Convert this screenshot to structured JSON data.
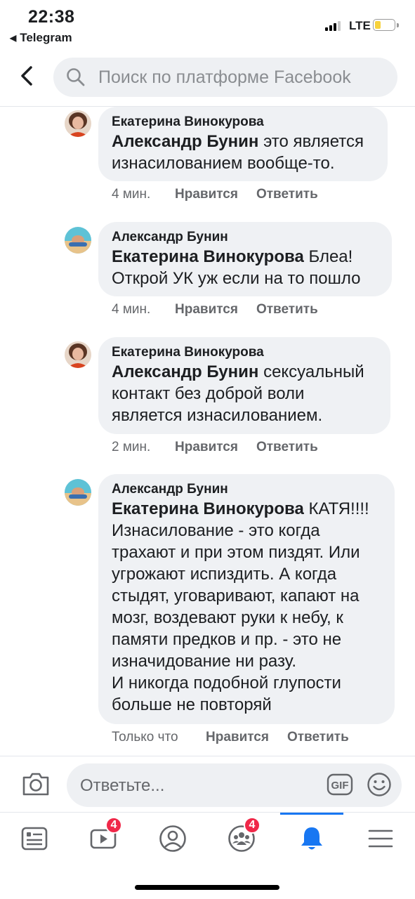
{
  "status_bar": {
    "time": "22:38",
    "back_app": "Telegram",
    "network": "LTE",
    "battery_level": 0.3
  },
  "header": {
    "search_placeholder": "Поиск по платформе Facebook"
  },
  "comments": [
    {
      "author": "Екатерина Винокурова",
      "mention": "Александр Бунин",
      "lines": [
        "это является",
        "изнасилованием вообще-то."
      ],
      "time": "4 мин.",
      "like_label": "Нравится",
      "reply_label": "Ответить"
    },
    {
      "author": "Александр Бунин",
      "mention": "Екатерина Винокурова",
      "lines": [
        "Блеа!",
        "Открой УК уж если на то пошло"
      ],
      "time": "4 мин.",
      "like_label": "Нравится",
      "reply_label": "Ответить"
    },
    {
      "author": "Екатерина Винокурова",
      "mention": "Александр Бунин",
      "lines": [
        "сексуальный",
        "контакт без доброй воли",
        "является изнасилованием."
      ],
      "time": "2 мин.",
      "like_label": "Нравится",
      "reply_label": "Ответить"
    },
    {
      "author": "Александр Бунин",
      "mention": "Екатерина Винокурова",
      "lines": [
        "КАТЯ!!!!",
        "Изнасилование - это когда",
        "трахают и при этом пиздят. Или",
        "угрожают испиздить. А когда",
        "стыдят, уговаривают, капают на",
        "мозг, воздевают руки к небу, к",
        "памяти предков и пр. - это не",
        "изначидование ни разу.",
        "И никогда подобной глупости",
        "больше не повторяй"
      ],
      "time": "Только что",
      "like_label": "Нравится",
      "reply_label": "Ответить"
    }
  ],
  "composer": {
    "placeholder": "Ответьте...",
    "gif_label": "GIF"
  },
  "tabbar": {
    "items": [
      {
        "icon": "news-feed-icon",
        "badge": ""
      },
      {
        "icon": "watch-video-icon",
        "badge": "4"
      },
      {
        "icon": "profile-icon",
        "badge": ""
      },
      {
        "icon": "groups-icon",
        "badge": "4"
      },
      {
        "icon": "notifications-bell-icon",
        "badge": "",
        "active": true
      },
      {
        "icon": "menu-icon",
        "badge": ""
      }
    ]
  },
  "colors": {
    "accent": "#1877f2",
    "badge": "#f02849",
    "bubble": "#eff1f4"
  }
}
